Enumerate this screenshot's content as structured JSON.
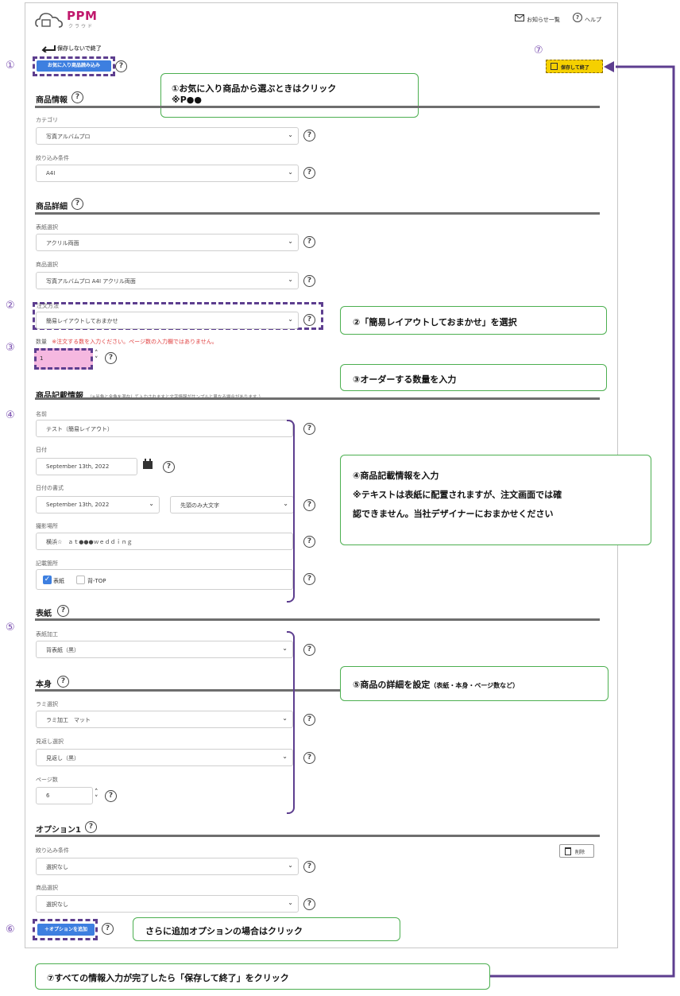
{
  "header": {
    "logo_text": "PPM",
    "logo_sub": "クラウド",
    "notice_link": "お知らせ一覧",
    "help_link": "ヘルプ"
  },
  "actions": {
    "back_label": "保存しないで終了",
    "favorite_button": "お気に入り商品読み込み",
    "save_button": "保存して終了",
    "delete_button": "削除",
    "add_option_button": "＋オプションを追加"
  },
  "sections": {
    "product_info": "商品情報",
    "product_detail": "商品詳細",
    "product_record": "商品記載情報",
    "product_record_note": "（※半角と全角を混在して入力されますと文字情報がサンプルと異なる場合があります。）",
    "cover": "表紙",
    "body": "本身",
    "option1": "オプション1"
  },
  "fields": {
    "category": {
      "label": "カテゴリ",
      "value": "写真アルバムプロ"
    },
    "filter": {
      "label": "絞り込み条件",
      "value": "A4I"
    },
    "cover_select": {
      "label": "表紙選択",
      "value": "アクリル両面"
    },
    "product_select": {
      "label": "商品選択",
      "value": "写真アルバムプロ A4I アクリル両面"
    },
    "order_method": {
      "label": "注文方法",
      "value": "簡易レイアウトしておまかせ"
    },
    "quantity": {
      "label": "数量",
      "note": "※注文する数を入力ください。ページ数の入力欄ではありません。",
      "value": "1"
    },
    "name": {
      "label": "名前",
      "value": "テスト（簡易レイアウト）"
    },
    "date": {
      "label": "日付",
      "value": "September 13th, 2022"
    },
    "date_format": {
      "label": "日付の書式",
      "value": "September 13th, 2022",
      "case_value": "先頭のみ大文字"
    },
    "location": {
      "label": "撮影場所",
      "value": "横浜☆　ａｔ●●●ｗｅｄｄｉｎｇ"
    },
    "placement": {
      "label": "記載箇所",
      "option1": "表紙",
      "option2": "背-TOP"
    },
    "cover_process": {
      "label": "表紙加工",
      "value": "背表紙（黒）"
    },
    "lami_select": {
      "label": "ラミ選択",
      "value": "ラミ加工　マット"
    },
    "endpaper": {
      "label": "見返し選択",
      "value": "見返し（黒）"
    },
    "pages": {
      "label": "ページ数",
      "value": "6"
    },
    "opt_filter": {
      "label": "絞り込み条件",
      "value": "選択なし"
    },
    "opt_product": {
      "label": "商品選択",
      "value": "選択なし"
    }
  },
  "markers": {
    "m1": "①",
    "m2": "②",
    "m3": "③",
    "m4": "④",
    "m5": "⑤",
    "m6": "⑥",
    "m7": "⑦"
  },
  "callouts": {
    "c1_line1": "①お気に入り商品から選ぶときはクリック",
    "c1_line2": "※P●●",
    "c2": "②「簡易レイアウトしておまかせ」を選択",
    "c3": "③オーダーする数量を入力",
    "c4_line1": "④商品記載情報を入力",
    "c4_line2": "※テキストは表紙に配置されますが、注文画面では確",
    "c4_line3": "認できません。当社デザイナーにおまかせください",
    "c5_main": "⑤商品の詳細を設定",
    "c5_small": "（表紙・本身・ページ数など）",
    "c6": "さらに追加オプションの場合はクリック",
    "c7": "⑦すべての情報入力が完了したら「保存して終了」をクリック"
  },
  "colors": {
    "accent_purple": "#5d3e8f",
    "button_blue": "#3d7fe0",
    "save_yellow": "#f5d000",
    "quantity_pink": "#f5b8e0",
    "callout_border": "#4caf50"
  }
}
